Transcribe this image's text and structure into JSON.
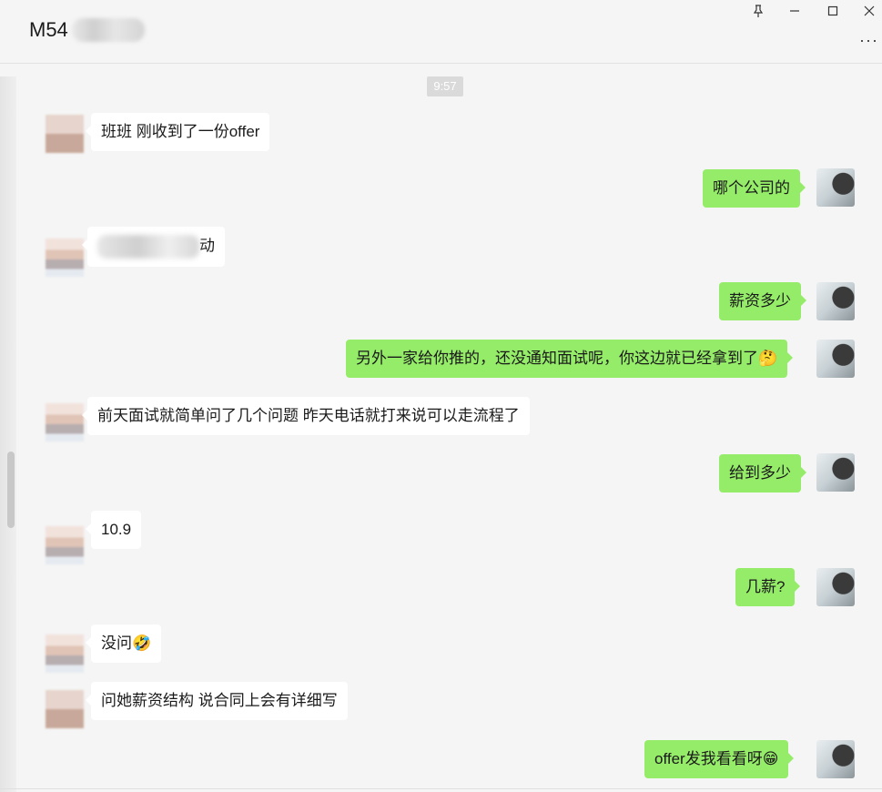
{
  "header": {
    "title": "M54",
    "controls": {
      "pin": "⊥",
      "minimize": "—",
      "maximize": "☐",
      "close": "✕"
    },
    "more": "···"
  },
  "chat": {
    "timestamp": "9:57",
    "messages": [
      {
        "side": "left",
        "text": "班班 刚收到了一份offer"
      },
      {
        "side": "right",
        "text": "哪个公司的"
      },
      {
        "side": "left",
        "text": "动"
      },
      {
        "side": "right",
        "text": "薪资多少"
      },
      {
        "side": "right",
        "text": "另外一家给你推的，还没通知面试呢，你这边就已经拿到了",
        "emoji": "🤔"
      },
      {
        "side": "left",
        "text": "前天面试就简单问了几个问题 昨天电话就打来说可以走流程了"
      },
      {
        "side": "right",
        "text": "给到多少"
      },
      {
        "side": "left",
        "text": "10.9"
      },
      {
        "side": "right",
        "text": "几薪?"
      },
      {
        "side": "left",
        "text": "没问",
        "emoji": "🤣"
      },
      {
        "side": "left",
        "text": "问她薪资结构 说合同上会有详细写"
      },
      {
        "side": "right",
        "text": "offer发我看看呀",
        "emoji": "😁"
      }
    ]
  },
  "colors": {
    "self_bubble": "#95ec69",
    "other_bubble": "#ffffff",
    "background": "#f5f5f5"
  }
}
